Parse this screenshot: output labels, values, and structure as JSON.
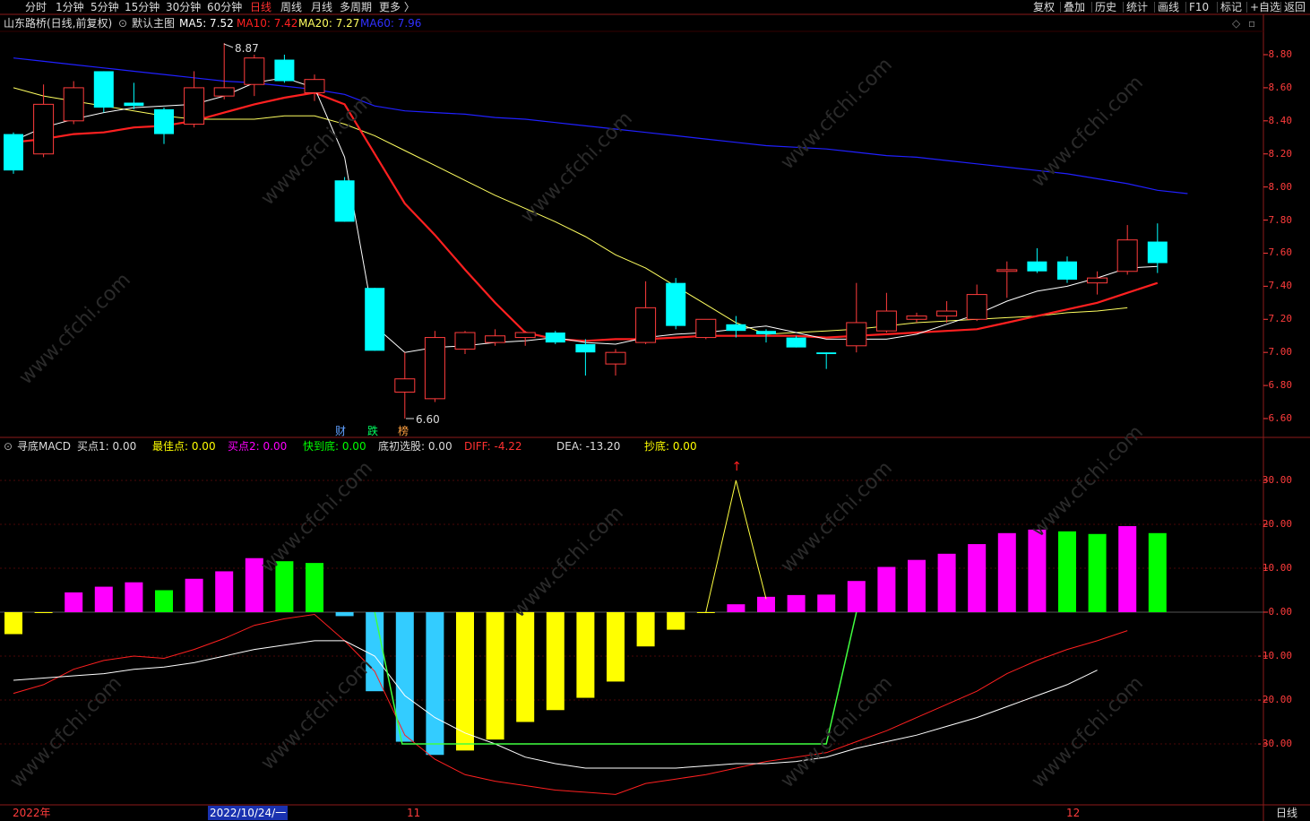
{
  "toolbar": {
    "tabs": [
      "分时",
      "1分钟",
      "5分钟",
      "15分钟",
      "30分钟",
      "60分钟",
      "日线",
      "周线",
      "月线",
      "多周期",
      "更多 〉"
    ],
    "active_tab": "日线",
    "right_buttons": [
      "复权",
      "叠加",
      "历史",
      "统计",
      "画线",
      "F10",
      "标记",
      "+自选",
      "返回"
    ]
  },
  "main": {
    "stock_title": "山东路桥(日线,前复权)",
    "template": "默认主图",
    "ma5": "MA5: 7.52",
    "ma10": "MA10: 7.42",
    "ma20": "MA20: 7.27",
    "ma60": "MA60: 7.96",
    "high_marker": "8.87",
    "low_marker": "6.60",
    "event_tags": [
      "财",
      "跌",
      "榜"
    ],
    "y_labels": [
      "8.80",
      "8.60",
      "8.40",
      "8.20",
      "8.00",
      "7.80",
      "7.60",
      "7.40",
      "7.20",
      "7.00",
      "6.80",
      "6.60"
    ]
  },
  "indicator": {
    "name": "寻底MACD",
    "fields": [
      {
        "label": "买点1:",
        "value": "0.00",
        "color": "#dcdcdc"
      },
      {
        "label": "最佳点:",
        "value": "0.00",
        "color": "#ffff00"
      },
      {
        "label": "买点2:",
        "value": "0.00",
        "color": "#ff00ff"
      },
      {
        "label": "快到底:",
        "value": "0.00",
        "color": "#00ff00"
      },
      {
        "label": "底初选股:",
        "value": "0.00",
        "color": "#dcdcdc"
      },
      {
        "label": "DIFF:",
        "value": "-4.22",
        "color": "#ff3030"
      },
      {
        "label": "DEA:",
        "value": "-13.20",
        "color": "#dcdcdc"
      },
      {
        "label": "抄底:",
        "value": "0.00",
        "color": "#ffff00"
      }
    ],
    "y_labels": [
      "30.00",
      "20.00",
      "10.00",
      "0.00",
      "-10.00",
      "-20.00",
      "-30.00"
    ]
  },
  "dates": {
    "left": "2022年",
    "cursor": "2022/10/24/一",
    "nov": "11",
    "dec": "12",
    "period": "日线"
  },
  "colors": {
    "up": "#ff3c3c",
    "down": "#00ffff",
    "ma5": "#ffffff",
    "ma10": "#ff2020",
    "ma20": "#ffff60",
    "ma60": "#2020ff"
  },
  "chart_data": {
    "type": "candlestick",
    "candles": [
      {
        "o": 8.1,
        "c": 8.32,
        "h": 8.33,
        "l": 8.08,
        "up": false
      },
      {
        "o": 8.2,
        "c": 8.5,
        "h": 8.62,
        "l": 8.18,
        "up": true
      },
      {
        "o": 8.4,
        "c": 8.6,
        "h": 8.64,
        "l": 8.38,
        "up": true
      },
      {
        "o": 8.7,
        "c": 8.48,
        "h": 8.7,
        "l": 8.45,
        "up": false
      },
      {
        "o": 8.51,
        "c": 8.49,
        "h": 8.63,
        "l": 8.47,
        "up": false
      },
      {
        "o": 8.47,
        "c": 8.32,
        "h": 8.48,
        "l": 8.26,
        "up": false
      },
      {
        "o": 8.38,
        "c": 8.6,
        "h": 8.7,
        "l": 8.36,
        "up": true
      },
      {
        "o": 8.55,
        "c": 8.6,
        "h": 8.87,
        "l": 8.53,
        "up": true
      },
      {
        "o": 8.62,
        "c": 8.78,
        "h": 8.8,
        "l": 8.55,
        "up": true
      },
      {
        "o": 8.77,
        "c": 8.64,
        "h": 8.8,
        "l": 8.63,
        "up": false
      },
      {
        "o": 8.57,
        "c": 8.65,
        "h": 8.68,
        "l": 8.52,
        "up": true
      },
      {
        "o": 8.04,
        "c": 7.79,
        "h": 8.06,
        "l": 7.79,
        "up": false
      },
      {
        "o": 7.39,
        "c": 7.01,
        "h": 7.39,
        "l": 7.01,
        "up": false
      },
      {
        "o": 6.76,
        "c": 6.84,
        "h": 7.0,
        "l": 6.6,
        "up": true
      },
      {
        "o": 6.72,
        "c": 7.09,
        "h": 7.13,
        "l": 6.7,
        "up": true
      },
      {
        "o": 7.02,
        "c": 7.12,
        "h": 7.13,
        "l": 6.99,
        "up": true
      },
      {
        "o": 7.06,
        "c": 7.1,
        "h": 7.14,
        "l": 7.04,
        "up": true
      },
      {
        "o": 7.09,
        "c": 7.12,
        "h": 7.13,
        "l": 7.04,
        "up": true
      },
      {
        "o": 7.12,
        "c": 7.06,
        "h": 7.13,
        "l": 7.05,
        "up": false
      },
      {
        "o": 7.05,
        "c": 7.0,
        "h": 7.08,
        "l": 6.86,
        "up": false
      },
      {
        "o": 6.93,
        "c": 7.0,
        "h": 7.02,
        "l": 6.86,
        "up": true
      },
      {
        "o": 7.06,
        "c": 7.27,
        "h": 7.43,
        "l": 7.05,
        "up": true
      },
      {
        "o": 7.42,
        "c": 7.16,
        "h": 7.45,
        "l": 7.14,
        "up": false
      },
      {
        "o": 7.09,
        "c": 7.2,
        "h": 7.2,
        "l": 7.08,
        "up": true
      },
      {
        "o": 7.17,
        "c": 7.13,
        "h": 7.22,
        "l": 7.09,
        "up": false
      },
      {
        "o": 7.13,
        "c": 7.11,
        "h": 7.14,
        "l": 7.06,
        "up": false
      },
      {
        "o": 7.09,
        "c": 7.03,
        "h": 7.1,
        "l": 7.03,
        "up": false
      },
      {
        "o": 7.0,
        "c": 6.99,
        "h": 7.0,
        "l": 6.9,
        "up": false
      },
      {
        "o": 7.04,
        "c": 7.18,
        "h": 7.42,
        "l": 7.0,
        "up": true
      },
      {
        "o": 7.13,
        "c": 7.25,
        "h": 7.36,
        "l": 7.12,
        "up": true
      },
      {
        "o": 7.2,
        "c": 7.22,
        "h": 7.24,
        "l": 7.18,
        "up": true
      },
      {
        "o": 7.22,
        "c": 7.25,
        "h": 7.31,
        "l": 7.18,
        "up": true
      },
      {
        "o": 7.2,
        "c": 7.35,
        "h": 7.41,
        "l": 7.19,
        "up": true
      },
      {
        "o": 7.49,
        "c": 7.5,
        "h": 7.55,
        "l": 7.33,
        "up": true
      },
      {
        "o": 7.55,
        "c": 7.49,
        "h": 7.63,
        "l": 7.48,
        "up": false
      },
      {
        "o": 7.55,
        "c": 7.44,
        "h": 7.58,
        "l": 7.42,
        "up": false
      },
      {
        "o": 7.42,
        "c": 7.45,
        "h": 7.49,
        "l": 7.35,
        "up": true
      },
      {
        "o": 7.49,
        "c": 7.68,
        "h": 7.77,
        "l": 7.47,
        "up": true
      },
      {
        "o": 7.67,
        "c": 7.54,
        "h": 7.78,
        "l": 7.48,
        "up": false
      }
    ],
    "ma5": [
      8.28,
      8.36,
      8.41,
      8.45,
      8.48,
      8.49,
      8.5,
      8.55,
      8.63,
      8.66,
      8.6,
      8.18,
      7.16,
      7.0,
      7.03,
      7.04,
      7.06,
      7.07,
      7.09,
      7.06,
      7.05,
      7.09,
      7.11,
      7.12,
      7.14,
      7.16,
      7.12,
      7.08,
      7.08,
      7.08,
      7.11,
      7.17,
      7.23,
      7.31,
      7.37,
      7.4,
      7.45,
      7.51,
      7.52
    ],
    "ma10": [
      8.27,
      8.29,
      8.32,
      8.33,
      8.36,
      8.37,
      8.4,
      8.45,
      8.5,
      8.54,
      8.57,
      8.5,
      8.2,
      7.9,
      7.71,
      7.5,
      7.3,
      7.12,
      7.08,
      7.07,
      7.08,
      7.08,
      7.09,
      7.1,
      7.1,
      7.1,
      7.1,
      7.09,
      7.1,
      7.11,
      7.12,
      7.13,
      7.14,
      7.18,
      7.22,
      7.26,
      7.3,
      7.36,
      7.42
    ],
    "ma20": [
      8.6,
      8.55,
      8.52,
      8.49,
      8.46,
      8.43,
      8.41,
      8.41,
      8.41,
      8.43,
      8.43,
      8.38,
      8.31,
      8.22,
      8.13,
      8.04,
      7.95,
      7.87,
      7.79,
      7.7,
      7.59,
      7.51,
      7.4,
      7.29,
      7.18,
      7.11,
      7.12,
      7.13,
      7.14,
      7.16,
      7.18,
      7.19,
      7.2,
      7.21,
      7.22,
      7.24,
      7.25,
      7.27
    ],
    "ma60": [
      8.78,
      8.76,
      8.74,
      8.72,
      8.7,
      8.68,
      8.66,
      8.64,
      8.63,
      8.61,
      8.59,
      8.56,
      8.49,
      8.46,
      8.45,
      8.44,
      8.42,
      8.41,
      8.39,
      8.37,
      8.35,
      8.33,
      8.31,
      8.29,
      8.27,
      8.25,
      8.24,
      8.23,
      8.21,
      8.19,
      8.18,
      8.16,
      8.14,
      8.12,
      8.1,
      8.08,
      8.05,
      8.02,
      7.98,
      7.96
    ],
    "macd_hist": [
      {
        "v": -5,
        "c": "yellow"
      },
      {
        "v": 0,
        "c": "yellow"
      },
      {
        "v": 4.5,
        "c": "magenta"
      },
      {
        "v": 5.8,
        "c": "magenta"
      },
      {
        "v": 6.8,
        "c": "magenta"
      },
      {
        "v": 5.0,
        "c": "green"
      },
      {
        "v": 7.6,
        "c": "magenta"
      },
      {
        "v": 9.3,
        "c": "magenta"
      },
      {
        "v": 12.3,
        "c": "magenta"
      },
      {
        "v": 11.6,
        "c": "green"
      },
      {
        "v": 11.2,
        "c": "green"
      },
      {
        "v": -0.9,
        "c": "cyan"
      },
      {
        "v": -18,
        "c": "cyan"
      },
      {
        "v": -29.5,
        "c": "cyan"
      },
      {
        "v": -32.5,
        "c": "cyan"
      },
      {
        "v": -31.5,
        "c": "yellow"
      },
      {
        "v": -29,
        "c": "yellow"
      },
      {
        "v": -25,
        "c": "yellow"
      },
      {
        "v": -22.3,
        "c": "yellow"
      },
      {
        "v": -19.5,
        "c": "yellow"
      },
      {
        "v": -15.8,
        "c": "yellow"
      },
      {
        "v": -7.8,
        "c": "yellow"
      },
      {
        "v": -4,
        "c": "yellow"
      },
      {
        "v": 0,
        "c": "yellow"
      },
      {
        "v": 1.8,
        "c": "magenta"
      },
      {
        "v": 3.5,
        "c": "magenta"
      },
      {
        "v": 3.9,
        "c": "magenta"
      },
      {
        "v": 4.0,
        "c": "magenta"
      },
      {
        "v": 7.1,
        "c": "magenta"
      },
      {
        "v": 10.3,
        "c": "magenta"
      },
      {
        "v": 11.9,
        "c": "magenta"
      },
      {
        "v": 13.3,
        "c": "magenta"
      },
      {
        "v": 15.5,
        "c": "magenta"
      },
      {
        "v": 18.0,
        "c": "magenta"
      },
      {
        "v": 18.8,
        "c": "magenta"
      },
      {
        "v": 18.4,
        "c": "green"
      },
      {
        "v": 17.8,
        "c": "green"
      },
      {
        "v": 19.6,
        "c": "magenta"
      },
      {
        "v": 18.0,
        "c": "green"
      }
    ],
    "diff": [
      -18.5,
      -16.5,
      -13,
      -11,
      -10,
      -10.5,
      -8.5,
      -6,
      -3,
      -1.5,
      -0.5,
      -6.5,
      -13.5,
      -28,
      -33.5,
      -37,
      -38.5,
      -39.5,
      -40.5,
      -41,
      -41.5,
      -39,
      -38,
      -37,
      -35.5,
      -34,
      -33,
      -32,
      -29.5,
      -27,
      -24,
      -21,
      -18,
      -14,
      -11,
      -8.5,
      -6.5,
      -4.2
    ],
    "dea": [
      -15.5,
      -15,
      -14.5,
      -14,
      -13,
      -12.5,
      -11.5,
      -10,
      -8.5,
      -7.5,
      -6.5,
      -6.5,
      -10,
      -19,
      -24,
      -27.5,
      -30,
      -33,
      -34.5,
      -35.5,
      -35.5,
      -35.5,
      -35.5,
      -35,
      -34.5,
      -34.5,
      -34,
      -33,
      -31,
      -29.5,
      -28,
      -26,
      -24,
      -21.5,
      -19,
      -16.5,
      -13.2
    ],
    "signal": [
      0,
      0,
      0,
      0,
      0,
      0,
      0,
      0,
      0,
      0,
      0,
      0,
      0,
      0,
      0,
      -30,
      -30,
      -30,
      -30,
      -30,
      -30,
      -30,
      -30,
      -30,
      0,
      30,
      0,
      0,
      0,
      0,
      -30,
      0,
      0,
      0,
      0,
      0,
      0,
      0,
      0,
      0
    ]
  }
}
